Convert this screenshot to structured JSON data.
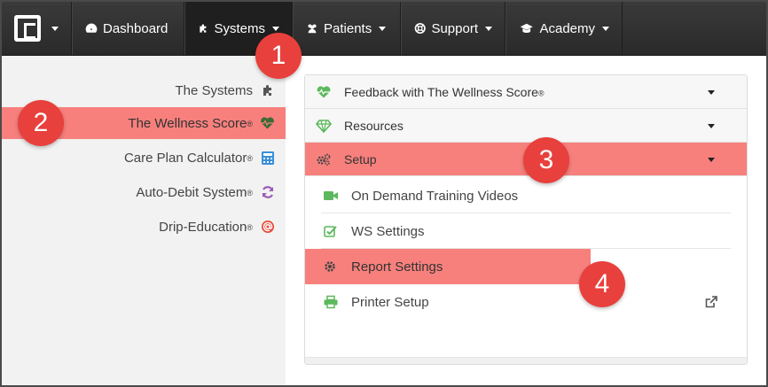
{
  "navbar": {
    "items": [
      {
        "label": "Dashboard",
        "icon": "dashboard-icon"
      },
      {
        "label": "Systems",
        "icon": "puzzle-icon"
      },
      {
        "label": "Patients",
        "icon": "users-icon"
      },
      {
        "label": "Support",
        "icon": "lifebuoy-icon"
      },
      {
        "label": "Academy",
        "icon": "graduation-cap-icon"
      }
    ],
    "colors": {
      "background": "#2e2e2e",
      "text": "#ffffff"
    }
  },
  "sidebar": {
    "items": [
      {
        "label": "The Systems",
        "icon": "puzzle-icon",
        "icon_color": "#444444",
        "reg": ""
      },
      {
        "label": "The Wellness Score",
        "icon": "heartbeat-icon",
        "icon_color": "#3a6b3a",
        "reg": "®"
      },
      {
        "label": "Care Plan Calculator",
        "icon": "calculator-icon",
        "icon_color": "#3a8fd9",
        "reg": "®"
      },
      {
        "label": "Auto-Debit System",
        "icon": "refresh-icon",
        "icon_color": "#9b59b6",
        "reg": "®"
      },
      {
        "label": "Drip-Education",
        "icon": "at-sign-icon",
        "icon_color": "#e74c3c",
        "reg": "®"
      }
    ]
  },
  "panel": {
    "sections": [
      {
        "label": "Feedback with The Wellness Score",
        "reg": "®",
        "icon": "heartbeat-icon"
      },
      {
        "label": "Resources",
        "reg": "",
        "icon": "diamond-icon"
      },
      {
        "label": "Setup",
        "reg": "",
        "icon": "cogs-icon"
      }
    ],
    "setup_items": [
      {
        "label": "On Demand Training Videos",
        "icon": "video-camera-icon"
      },
      {
        "label": "WS Settings",
        "icon": "checkbox-icon"
      },
      {
        "label": "Report Settings",
        "icon": "gear-icon"
      },
      {
        "label": "Printer Setup",
        "icon": "printer-icon"
      }
    ]
  },
  "badges": [
    "1",
    "2",
    "3",
    "4"
  ],
  "colors": {
    "highlight": "#f7807d",
    "badge": "#e8403c",
    "green_icon": "#5cb85c"
  }
}
